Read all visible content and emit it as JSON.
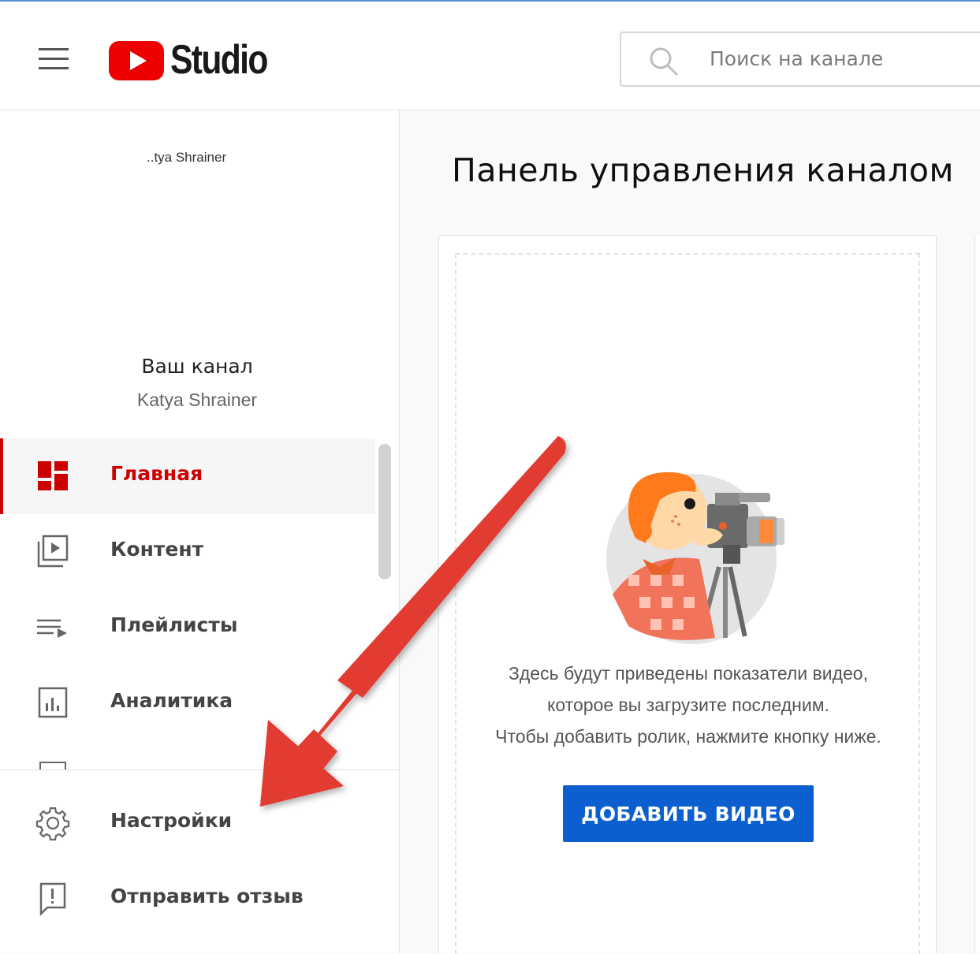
{
  "header": {
    "app_name": "Studio",
    "search": {
      "placeholder": "Поиск на канале"
    }
  },
  "sidebar": {
    "avatar_alt": "..tya Shrainer",
    "channel_title": "Ваш канал",
    "channel_name": "Katya Shrainer",
    "items": [
      {
        "label": "Главная",
        "icon": "dashboard-icon",
        "active": true
      },
      {
        "label": "Контент",
        "icon": "video-content-icon"
      },
      {
        "label": "Плейлисты",
        "icon": "playlist-icon"
      },
      {
        "label": "Аналитика",
        "icon": "analytics-icon"
      }
    ],
    "footer_items": [
      {
        "label": "Настройки",
        "icon": "gear-icon"
      },
      {
        "label": "Отправить отзыв",
        "icon": "feedback-icon"
      }
    ]
  },
  "main": {
    "title": "Панель управления каналом",
    "card": {
      "lines": [
        "Здесь будут приведены показатели видео,",
        "которое вы загрузите последним.",
        "Чтобы добавить ролик, нажмите кнопку ниже."
      ],
      "button_label": "ДОБАВИТЬ ВИДЕО"
    }
  },
  "colors": {
    "brand_red": "#cc0000",
    "primary_blue": "#0b5fce",
    "annotation_arrow": "#e23b32"
  }
}
